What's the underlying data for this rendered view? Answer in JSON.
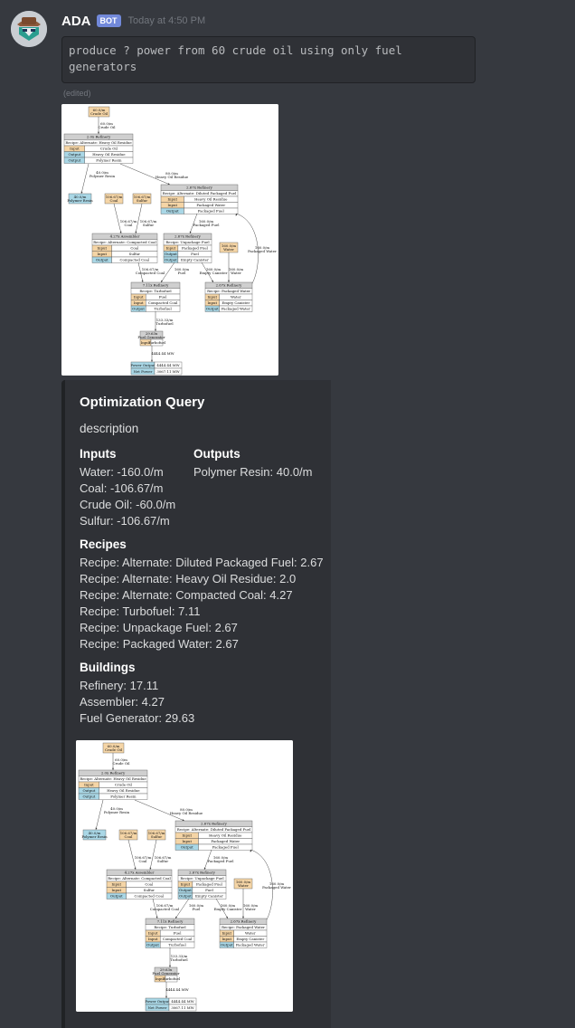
{
  "message": {
    "username": "ADA",
    "badge": "BOT",
    "timestamp": "Today at 4:50 PM",
    "command": "produce ? power from 60 crude oil using only fuel\ngenerators",
    "edited": "(edited)"
  },
  "embed": {
    "title": "Optimization Query",
    "description": "description",
    "inputs_title": "Inputs",
    "inputs": [
      "Water: -160.0/m",
      "Coal: -106.67/m",
      "Crude Oil: -60.0/m",
      "Sulfur: -106.67/m"
    ],
    "outputs_title": "Outputs",
    "outputs": [
      "Polymer Resin: 40.0/m"
    ],
    "recipes_title": "Recipes",
    "recipes": [
      "Recipe: Alternate: Diluted Packaged Fuel: 2.67",
      "Recipe: Alternate: Heavy Oil Residue: 2.0",
      "Recipe: Alternate: Compacted Coal: 4.27",
      "Recipe: Turbofuel: 7.11",
      "Recipe: Unpackage Fuel: 2.67",
      "Recipe: Packaged Water: 2.67"
    ],
    "buildings_title": "Buildings",
    "buildings": [
      "Refinery: 17.11",
      "Assembler: 4.27",
      "Fuel Generator: 29.63"
    ]
  },
  "graph": {
    "colors": {
      "input": "#f5d5a6",
      "output": "#a9d7e6",
      "header": "#cfcfcf",
      "edge": "#333333"
    },
    "crude": [
      "60.0/m",
      "Crude Oil"
    ],
    "e_crude": [
      "60.0/m",
      "Crude Oil"
    ],
    "ref1": {
      "head": "2.0x Refinery",
      "recipe": "Recipe: Alternate: Heavy Oil Residue",
      "rows": [
        [
          "Input",
          "Crude Oil"
        ],
        [
          "Output",
          "Heavy Oil Residue"
        ],
        [
          "Output",
          "Polymer Resin"
        ]
      ]
    },
    "e_resin": [
      "40.0/m",
      "Polymer Resin"
    ],
    "e_heavy": [
      "80.0/m",
      "Heavy Oil Residue"
    ],
    "polyout": [
      "40.0/m",
      "Polymer Resin"
    ],
    "coal": [
      "106.67/m",
      "Coal"
    ],
    "sulfur": [
      "106.67/m",
      "Sulfur"
    ],
    "ref2": {
      "head": "2.67x Refinery",
      "recipe": "Recipe: Alternate: Diluted Packaged Fuel",
      "rows": [
        [
          "Input",
          "Heavy Oil Residue"
        ],
        [
          "Input",
          "Packaged Water"
        ],
        [
          "Output",
          "Packaged Fuel"
        ]
      ]
    },
    "e_coal": [
      "106.67/m",
      "Coal"
    ],
    "e_sulfur": [
      "106.67/m",
      "Sulfur"
    ],
    "e_pfuel": [
      "160.0/m",
      "Packaged Fuel"
    ],
    "asm": {
      "head": "4.27x Assembler",
      "recipe": "Recipe: Alternate: Compacted Coal",
      "rows": [
        [
          "Input",
          "Coal"
        ],
        [
          "Input",
          "Sulfur"
        ],
        [
          "Output",
          "Compacted Coal"
        ]
      ]
    },
    "ref3": {
      "head": "2.67x Refinery",
      "recipe": "Recipe: Unpackage Fuel",
      "rows": [
        [
          "Input",
          "Packaged Fuel"
        ],
        [
          "Output",
          "Fuel"
        ],
        [
          "Output",
          "Empty Canister"
        ]
      ]
    },
    "water": [
      "160.0/m",
      "Water"
    ],
    "e_pwater": [
      "160.0/m",
      "Packaged Water"
    ],
    "e_ccoal": [
      "106.67/m",
      "Compacted Coal"
    ],
    "e_fuel": [
      "160.0/m",
      "Fuel"
    ],
    "e_canister": [
      "160.0/m",
      "Empty Canister"
    ],
    "e_water": [
      "160.0/m",
      "Water"
    ],
    "ref4": {
      "head": "7.11x Refinery",
      "recipe": "Recipe: Turbofuel",
      "rows": [
        [
          "Input",
          "Fuel"
        ],
        [
          "Input",
          "Compacted Coal"
        ],
        [
          "Output",
          "Turbofuel"
        ]
      ]
    },
    "ref5": {
      "head": "2.67x Refinery",
      "recipe": "Recipe: Packaged Water",
      "rows": [
        [
          "Input",
          "Water"
        ],
        [
          "Input",
          "Empty Canister"
        ],
        [
          "Output",
          "Packaged Water"
        ]
      ]
    },
    "e_turbo": [
      "133.33/m",
      "Turbofuel"
    ],
    "gen": {
      "head": [
        "29.63x",
        "Fuel Generator"
      ],
      "rows": [
        [
          "Input",
          "Turbofuel"
        ]
      ]
    },
    "e_power": [
      "4444.44 MW"
    ],
    "power": {
      "rows": [
        [
          "Power Output",
          "4444.44 MW"
        ],
        [
          "Net Power",
          "3067.11 MW"
        ]
      ]
    }
  }
}
